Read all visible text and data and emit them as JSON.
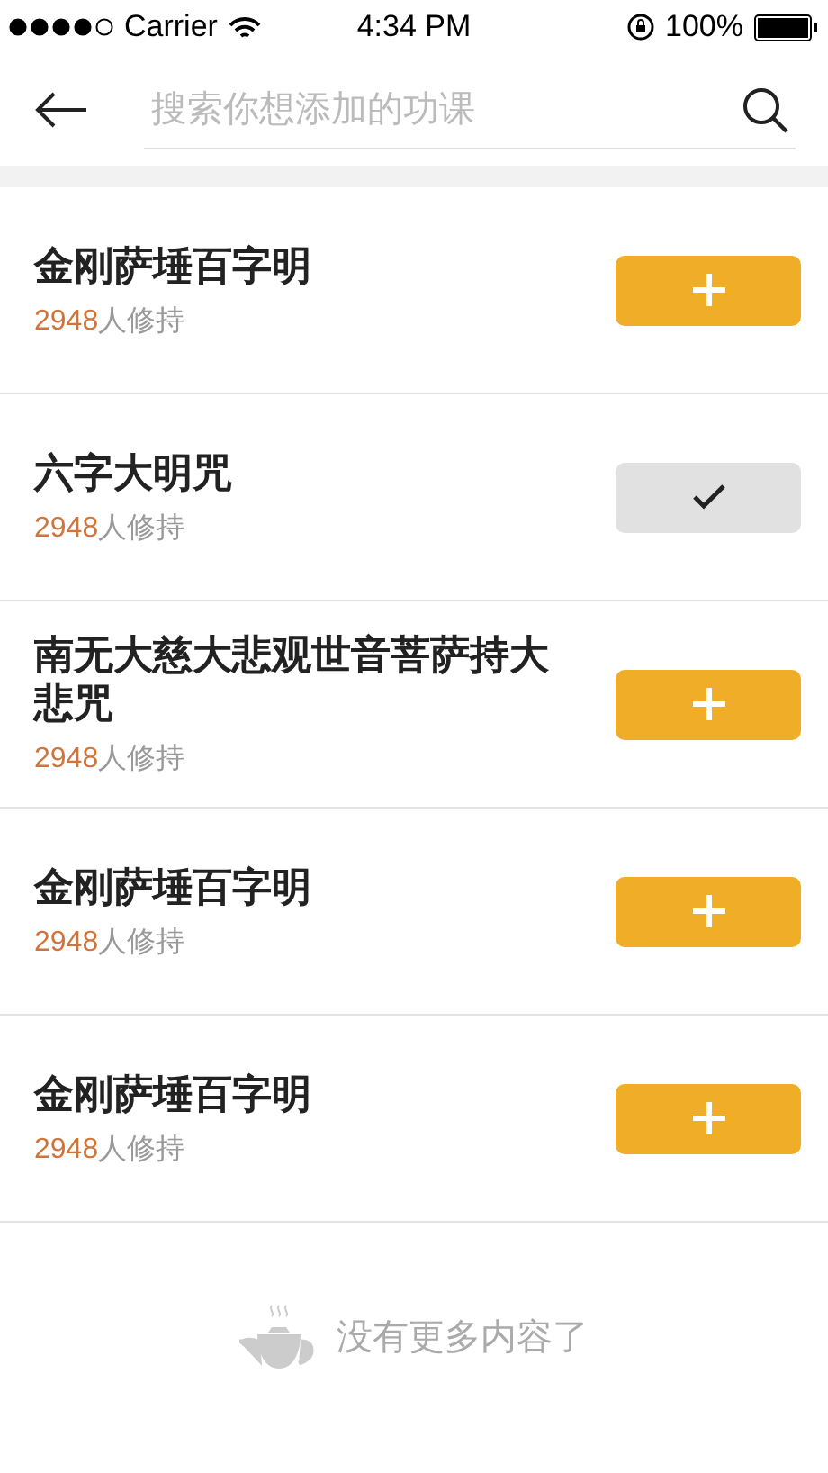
{
  "status_bar": {
    "carrier": "Carrier",
    "time": "4:34 PM",
    "battery": "100%"
  },
  "search": {
    "placeholder": "搜索你想添加的功课"
  },
  "items": [
    {
      "title": "金刚萨埵百字明",
      "count": "2948",
      "suffix": "人修持",
      "added": false
    },
    {
      "title": "六字大明咒",
      "count": "2948",
      "suffix": "人修持",
      "added": true
    },
    {
      "title": "南无大慈大悲观世音菩萨持大悲咒",
      "count": "2948",
      "suffix": "人修持",
      "added": false
    },
    {
      "title": "金刚萨埵百字明",
      "count": "2948",
      "suffix": "人修持",
      "added": false
    },
    {
      "title": "金刚萨埵百字明",
      "count": "2948",
      "suffix": "人修持",
      "added": false
    }
  ],
  "footer": {
    "text": "没有更多内容了"
  }
}
